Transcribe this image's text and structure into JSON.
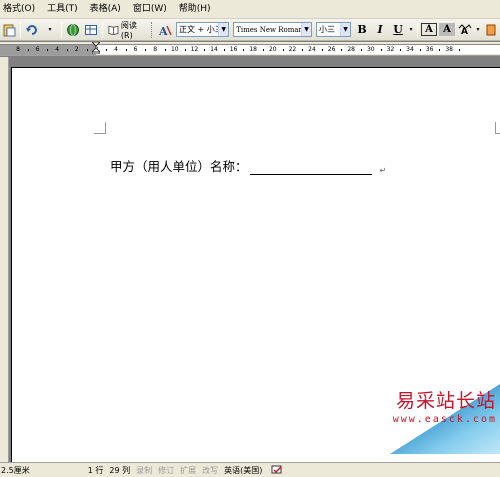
{
  "menu": {
    "items": [
      "格式(O)",
      "工具(T)",
      "表格(A)",
      "窗口(W)",
      "帮助(H)"
    ]
  },
  "toolbar": {
    "reading_label": "阅读(R)",
    "style_value": "正文 + 小三",
    "font_value": "Times New Roman",
    "size_value": "小三",
    "bold_label": "B",
    "italic_label": "I",
    "underline_label": "U",
    "font_color_label": "A",
    "char_shading_label": "A",
    "char_scale_label": "A"
  },
  "ruler": {
    "numbers": [
      "8",
      "6",
      "4",
      "2",
      "2",
      "4",
      "6",
      "8",
      "10",
      "12",
      "14",
      "16",
      "18",
      "20",
      "22",
      "24",
      "26",
      "28",
      "30",
      "32",
      "34",
      "36",
      "38"
    ]
  },
  "document": {
    "line_text": "甲方（用人单位）名称：",
    "para_mark": "↵"
  },
  "watermark": {
    "title": "易采站长站",
    "url": "www.easck.com"
  },
  "status": {
    "position": "2.5厘米",
    "line": "1 行",
    "column": "29 列",
    "rec": "录制",
    "trk": "修订",
    "ext": "扩展",
    "ovr": "改写",
    "language": "英语(美国)"
  },
  "colors": {
    "chrome": "#ECE9D8",
    "workspace": "#808080",
    "watermark_red": "#c8142a",
    "watermark_blue": "#1e88c8"
  }
}
